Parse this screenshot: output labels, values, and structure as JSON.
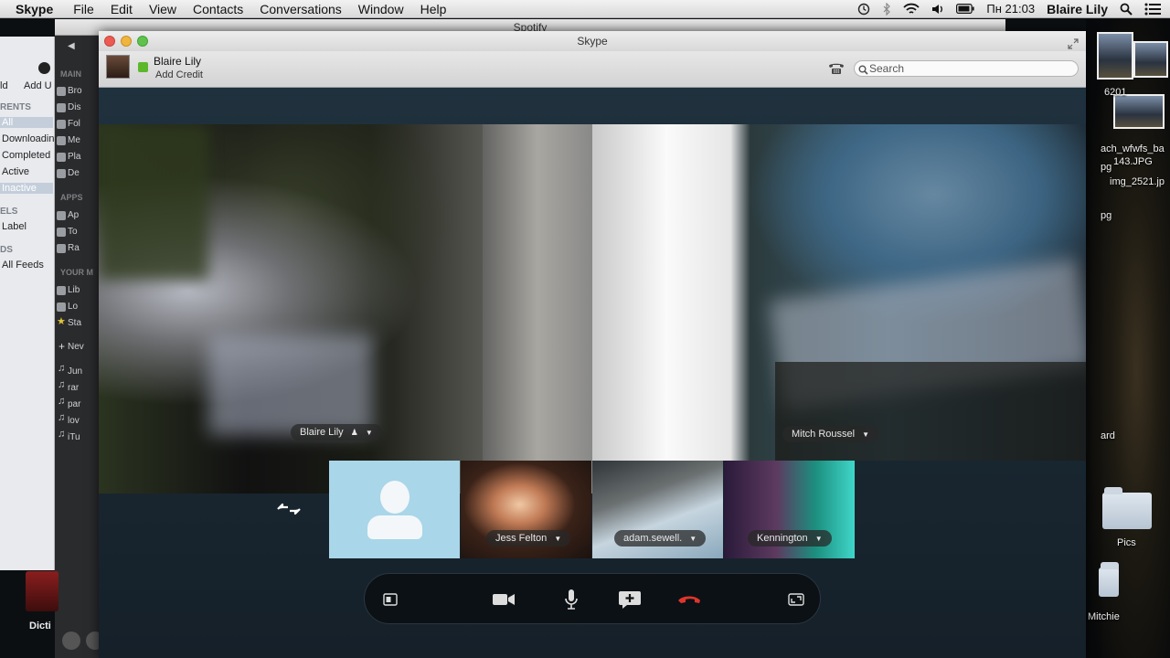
{
  "menubar": {
    "app_name": "Skype",
    "menus": [
      "File",
      "Edit",
      "View",
      "Contacts",
      "Conversations",
      "Window",
      "Help"
    ],
    "clock": "Пн 21:03",
    "user": "Blaire Lily"
  },
  "spotify": {
    "title": "Spotify",
    "sections": {
      "main": "MAIN",
      "apps": "APPS",
      "your_music": "YOUR M"
    },
    "main_items": [
      "Bro",
      "Dis",
      "Fol",
      "Me",
      "Pla",
      "De"
    ],
    "app_items": [
      "Ap",
      "To",
      "Ra"
    ],
    "music_items": [
      "Lib",
      "Lo",
      "Sta"
    ],
    "new_label": "Nev",
    "playlists": [
      "Jun",
      "rar",
      "par",
      "lov",
      "iTu"
    ]
  },
  "torrent": {
    "toolbar": [
      "ld",
      "Add U"
    ],
    "section_torrents": "RENTS",
    "filters": [
      "All",
      "Downloading",
      "Completed",
      "Active",
      "Inactive"
    ],
    "section_labels": "ELS",
    "label_item": "Label",
    "section_feeds": "DS",
    "feeds_item": "All Feeds"
  },
  "dock": {
    "dictionary": "Dicti"
  },
  "desktop": {
    "files": [
      "6201",
      "ach_wfwfs_ba",
      "143.JPG",
      "img_2521.jp",
      "pg",
      "pg",
      "ard"
    ],
    "folders": [
      "Pics",
      "Mitchie"
    ]
  },
  "skype": {
    "window_title": "Skype",
    "self_name": "Blaire Lily",
    "add_credit": "Add Credit",
    "search_placeholder": "Search",
    "participants": {
      "main_left": "Blaire Lily",
      "main_right": "Mitch Roussel",
      "tile_1": "Jess Felton",
      "tile_2": "adam.sewell.",
      "tile_3": "Kennington"
    },
    "colors": {
      "hangup": "#e0352b",
      "status_online": "#5cb82a",
      "accent": "#1c2b36"
    }
  }
}
